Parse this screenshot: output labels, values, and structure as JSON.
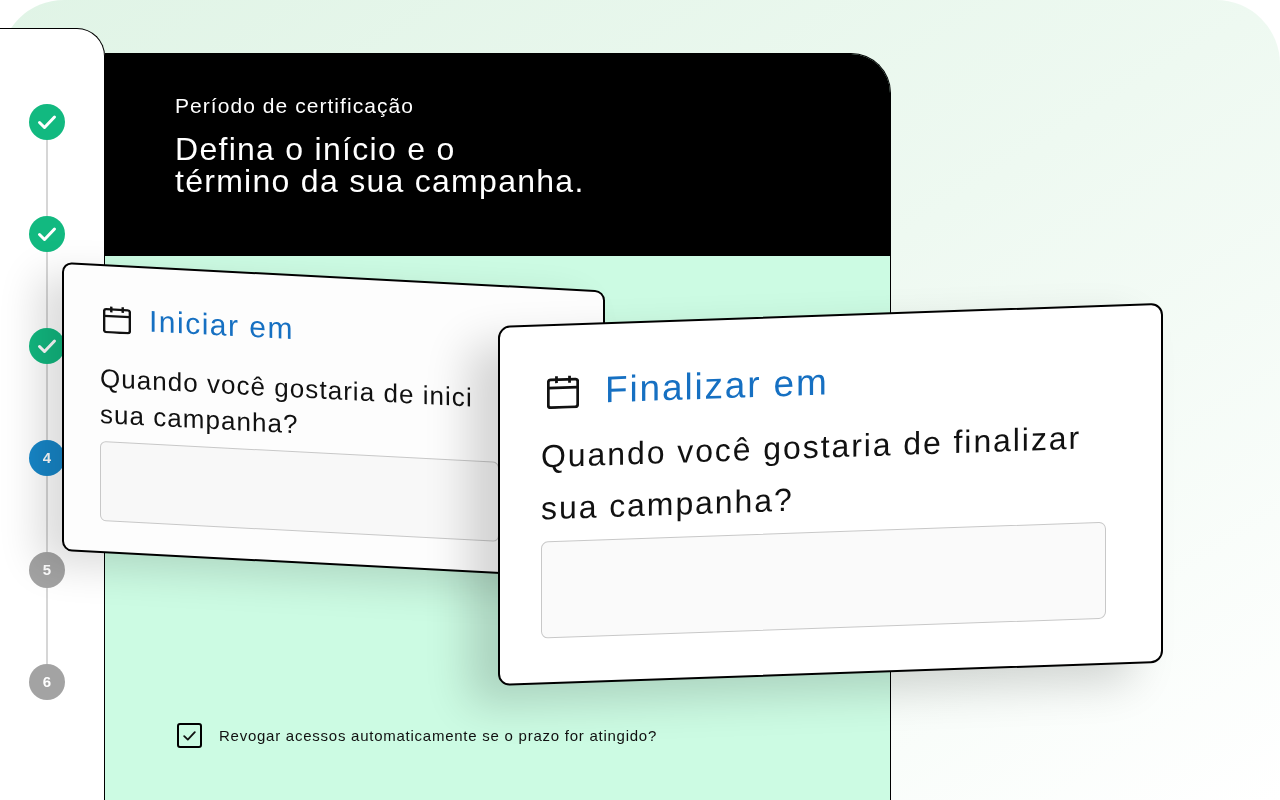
{
  "stepper": {
    "steps": [
      {
        "completed": true,
        "current": false
      },
      {
        "completed": true,
        "current": false
      },
      {
        "completed": true,
        "current": false
      },
      {
        "label": "4",
        "completed": false,
        "current": true
      },
      {
        "label": "5",
        "completed": false,
        "current": false
      },
      {
        "label": "6",
        "completed": false,
        "current": false
      }
    ]
  },
  "header": {
    "eyebrow": "Período de certificação",
    "title": "Defina o início e o\ntérmino da sua campanha."
  },
  "cards": [
    {
      "title": "Iniciar em",
      "question": "Quando você gostaria de inici\nsua campanha?"
    },
    {
      "title": "Finalizar em",
      "question": "Quando você gostaria de finalizar\nsua campanha?"
    }
  ],
  "checkbox": {
    "label": "Revogar acessos automaticamente se o prazo for atingido?",
    "checked": true
  }
}
